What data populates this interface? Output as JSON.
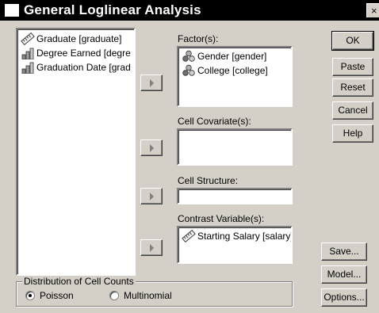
{
  "window": {
    "title": "General Loglinear Analysis",
    "close_glyph": "×"
  },
  "source_list": {
    "items": [
      {
        "label": "Graduate [graduate]",
        "icon": "ruler-icon"
      },
      {
        "label": "Degree Earned [degre",
        "icon": "bar-chart-icon"
      },
      {
        "label": "Graduation Date [grad",
        "icon": "bar-chart-icon"
      }
    ]
  },
  "factors": {
    "label": "Factor(s):",
    "items": [
      {
        "label": "Gender [gender]",
        "icon": "nominal-balls-icon"
      },
      {
        "label": "College [college]",
        "icon": "nominal-balls-icon"
      }
    ]
  },
  "cell_covariates": {
    "label": "Cell Covariate(s):"
  },
  "cell_structure": {
    "label": "Cell Structure:",
    "value": ""
  },
  "contrast_variables": {
    "label": "Contrast Variable(s):",
    "items": [
      {
        "label": "Starting Salary [salary]",
        "icon": "ruler-icon"
      }
    ]
  },
  "buttons": {
    "ok": "OK",
    "paste": "Paste",
    "reset": "Reset",
    "cancel": "Cancel",
    "help": "Help",
    "save": "Save...",
    "model": "Model...",
    "options": "Options..."
  },
  "distribution": {
    "title": "Distribution of Cell Counts",
    "options": [
      {
        "label": "Poisson",
        "selected": true
      },
      {
        "label": "Multinomial",
        "selected": false
      }
    ]
  }
}
